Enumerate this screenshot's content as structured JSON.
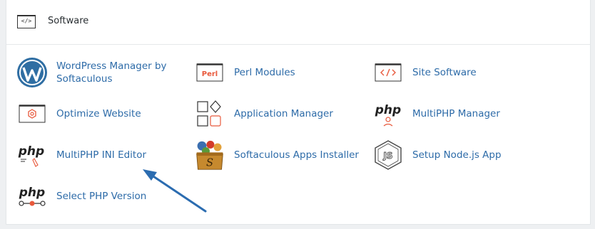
{
  "section": {
    "title": "Software",
    "icon": "code-window-icon"
  },
  "items": [
    {
      "label": "WordPress Manager by Softaculous",
      "icon": "wordpress-icon"
    },
    {
      "label": "Perl Modules",
      "icon": "perl-icon",
      "badge": "Perl"
    },
    {
      "label": "Site Software",
      "icon": "code-window-icon"
    },
    {
      "label": "Optimize Website",
      "icon": "gear-window-icon"
    },
    {
      "label": "Application Manager",
      "icon": "shapes-icon"
    },
    {
      "label": "MultiPHP Manager",
      "icon": "php-manager-icon",
      "badge": "php"
    },
    {
      "label": "MultiPHP INI Editor",
      "icon": "php-ini-icon",
      "badge": "php"
    },
    {
      "label": "Softaculous Apps Installer",
      "icon": "softaculous-box-icon"
    },
    {
      "label": "Setup Node.js App",
      "icon": "nodejs-icon"
    },
    {
      "label": "Select PHP Version",
      "icon": "php-version-icon",
      "badge": "php"
    }
  ],
  "colors": {
    "link": "#2d6ba8",
    "accent_orange": "#e8593c",
    "arrow": "#2b6cb0"
  }
}
